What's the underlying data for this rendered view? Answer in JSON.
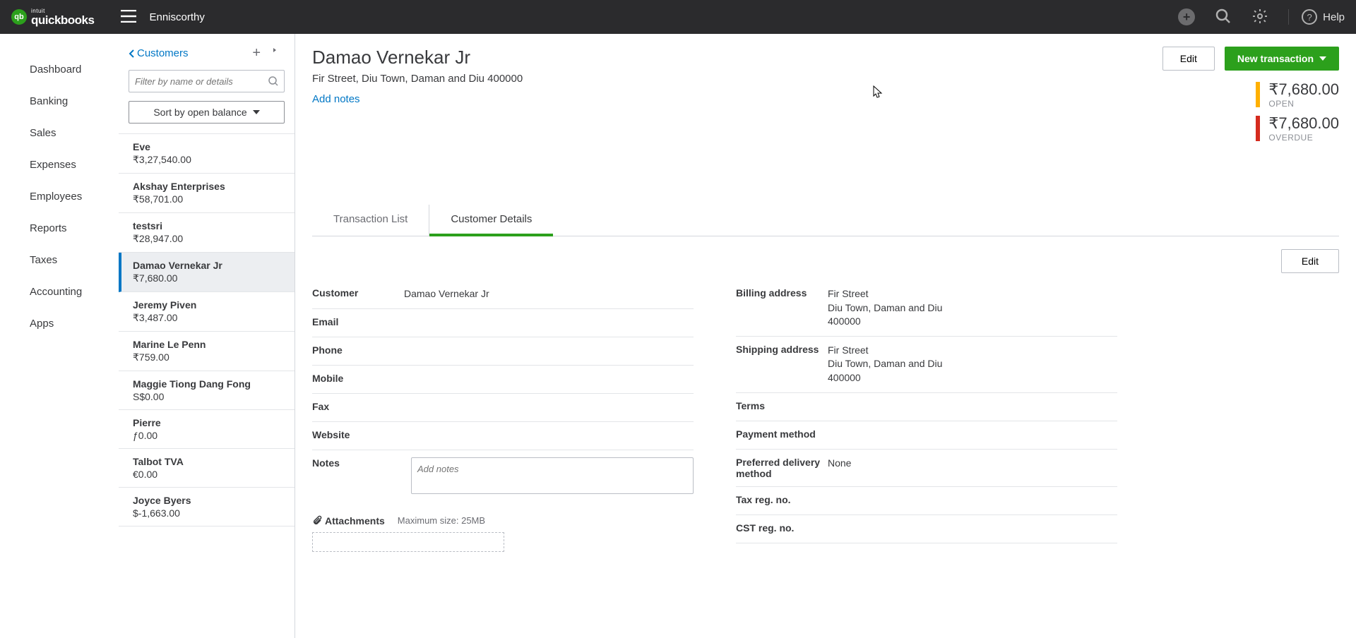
{
  "header": {
    "brand_intuit": "intuit",
    "brand_name": "quickbooks",
    "company": "Enniscorthy",
    "help": "Help"
  },
  "nav": {
    "items": [
      "Dashboard",
      "Banking",
      "Sales",
      "Expenses",
      "Employees",
      "Reports",
      "Taxes",
      "Accounting",
      "Apps"
    ]
  },
  "customer_panel": {
    "back_label": "Customers",
    "filter_placeholder": "Filter by name or details",
    "sort_label": "Sort by open balance",
    "customers": [
      {
        "name": "Eve",
        "balance": "₹3,27,540.00"
      },
      {
        "name": "Akshay Enterprises",
        "balance": "₹58,701.00"
      },
      {
        "name": "testsri",
        "balance": "₹28,947.00"
      },
      {
        "name": "Damao Vernekar Jr",
        "balance": "₹7,680.00",
        "selected": true
      },
      {
        "name": "Jeremy Piven",
        "balance": "₹3,487.00"
      },
      {
        "name": "Marine Le Penn",
        "balance": "₹759.00"
      },
      {
        "name": "Maggie Tiong Dang Fong",
        "balance": "S$0.00"
      },
      {
        "name": "Pierre",
        "balance": "ƒ0.00"
      },
      {
        "name": "Talbot TVA",
        "balance": "€0.00"
      },
      {
        "name": "Joyce Byers",
        "balance": "$-1,663.00"
      }
    ]
  },
  "detail": {
    "title": "Damao Vernekar Jr",
    "address": "Fir Street, Diu Town, Daman and Diu 400000",
    "add_notes": "Add notes",
    "edit_btn": "Edit",
    "new_trans_btn": "New transaction",
    "open_amount": "₹7,680.00",
    "open_label": "OPEN",
    "overdue_amount": "₹7,680.00",
    "overdue_label": "OVERDUE",
    "tabs": {
      "transaction_list": "Transaction List",
      "customer_details": "Customer Details"
    },
    "edit_sm": "Edit",
    "fields": {
      "customer_label": "Customer",
      "customer_value": "Damao Vernekar Jr",
      "email_label": "Email",
      "phone_label": "Phone",
      "mobile_label": "Mobile",
      "fax_label": "Fax",
      "website_label": "Website",
      "notes_label": "Notes",
      "notes_placeholder": "Add notes",
      "billing_label": "Billing address",
      "billing_value": "Fir Street\nDiu Town, Daman and Diu\n400000",
      "shipping_label": "Shipping address",
      "shipping_value": "Fir Street\nDiu Town, Daman and Diu\n400000",
      "terms_label": "Terms",
      "payment_method_label": "Payment method",
      "pref_delivery_label": "Preferred delivery method",
      "pref_delivery_value": "None",
      "tax_reg_label": "Tax reg. no.",
      "cst_reg_label": "CST reg. no."
    },
    "attachments_label": "Attachments",
    "attachments_max": "Maximum size: 25MB"
  }
}
